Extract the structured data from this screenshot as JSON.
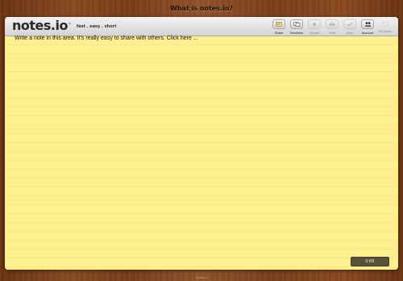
{
  "top_link": "What is notes.io?",
  "logo": {
    "name": "notes.",
    "suffix": "io",
    "tm": "™"
  },
  "tagline": "fast . easy . short",
  "toolbar": [
    {
      "label": "Share",
      "icon": "share-icon",
      "enabled": true
    },
    {
      "label": "Numbers",
      "icon": "numbers-icon",
      "enabled": true
    },
    {
      "label": "Upload",
      "icon": "upload-icon",
      "enabled": false
    },
    {
      "label": "Print",
      "icon": "print-icon",
      "enabled": false
    },
    {
      "label": "Save",
      "icon": "checkmark-icon",
      "enabled": false
    },
    {
      "label": "Account",
      "icon": "users-icon",
      "enabled": true
    },
    {
      "label": "My Notes",
      "icon": "notes-icon",
      "enabled": false
    }
  ],
  "note": {
    "placeholder": "Write a note in this area.  It's really easy to share with others. Click here ..."
  },
  "size_badge": "0 KB",
  "bottom_text": "Notes.io",
  "colors": {
    "note_bg": "#fff08f",
    "header_bg": "#e2e2e2",
    "badge_bg": "#56533a"
  }
}
